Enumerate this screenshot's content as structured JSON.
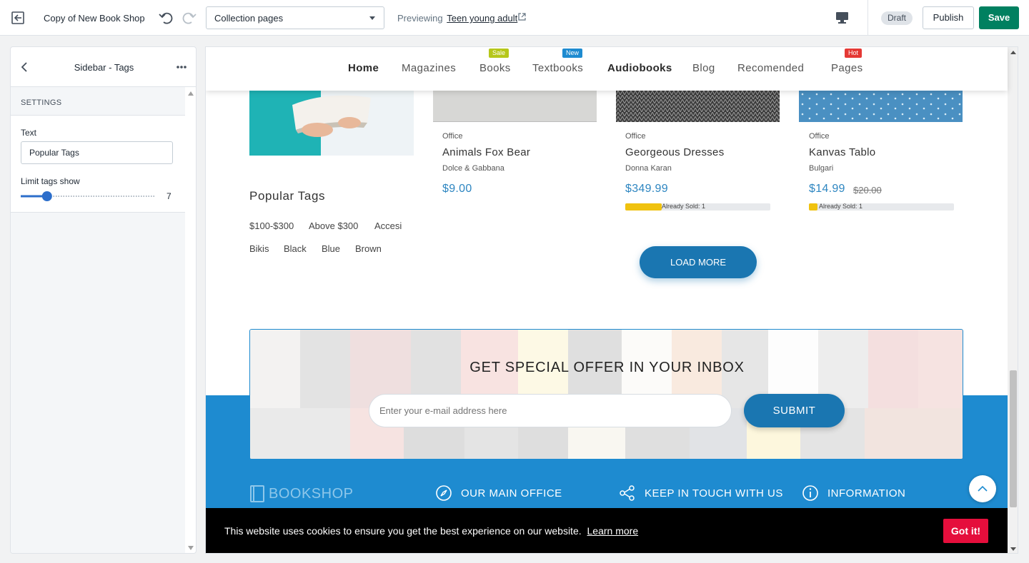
{
  "topbar": {
    "shop_name": "Copy of New Book Shop",
    "template_select": "Collection pages",
    "previewing_label": "Previewing",
    "previewing_link": "Teen young adult",
    "status_badge": "Draft",
    "publish_label": "Publish",
    "save_label": "Save",
    "accent": "#008060"
  },
  "sidebar": {
    "title": "Sidebar - Tags",
    "section_label": "SETTINGS",
    "text_label": "Text",
    "text_value": "Popular Tags",
    "limit_label": "Limit tags show",
    "limit_value": "7",
    "limit_fraction": 0.16
  },
  "store": {
    "nav": [
      {
        "label": "Home",
        "bold": true
      },
      {
        "label": "Magazines"
      },
      {
        "label": "Books",
        "badge": "Sale",
        "badge_color": "#b6c71a"
      },
      {
        "label": "Textbooks",
        "badge": "New",
        "badge_color": "#1e8bd0"
      },
      {
        "label": "Audiobooks",
        "bold": true
      },
      {
        "label": "Blog"
      },
      {
        "label": "Recomended"
      },
      {
        "label": "Pages",
        "badge": "Hot",
        "badge_color": "#e53935"
      }
    ],
    "products": [
      {
        "category": "Office",
        "name": "Animals Fox Bear",
        "brand": "Dolce & Gabbana",
        "price": "$9.00",
        "old_price": "",
        "sold_label": "",
        "sold_fraction": 0
      },
      {
        "category": "Office",
        "name": "Georgeous Dresses",
        "brand": "Donna Karan",
        "price": "$349.99",
        "old_price": "",
        "sold_label": "Already Sold: 1",
        "sold_fraction": 0.25
      },
      {
        "category": "Office",
        "name": "Kanvas Tablo",
        "brand": "Bulgari",
        "price": "$14.99",
        "old_price": "$20.00",
        "sold_label": "Already Sold: 1",
        "sold_fraction": 0.06
      }
    ],
    "tags_title": "Popular Tags",
    "tags_row1": [
      "$100-$300",
      "Above $300",
      "Accesi"
    ],
    "tags_row2": [
      "Bikis",
      "Black",
      "Blue",
      "Brown"
    ],
    "load_more": "LOAD MORE",
    "newsletter_title": "GET SPECIAL OFFER IN YOUR INBOX",
    "newsletter_placeholder": "Enter your e-mail address here",
    "newsletter_submit": "SUBMIT",
    "footer_logo": "BOOKSHOP",
    "footer_headings": [
      "OUR MAIN OFFICE",
      "KEEP IN TOUCH WITH US",
      "INFORMATION"
    ],
    "cookie_message": "This website uses cookies to ensure you get the best experience on our website.",
    "cookie_learn_more": "Learn more",
    "cookie_button": "Got it!",
    "brand_blue": "#1e8bd0"
  }
}
